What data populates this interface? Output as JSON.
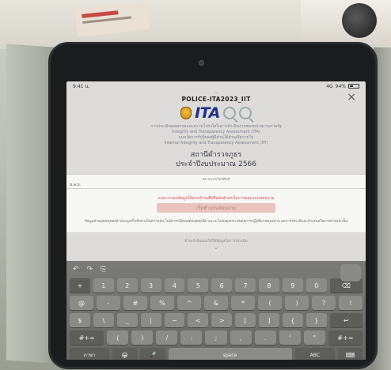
{
  "status_bar": {
    "time": "9:41 น.",
    "signal": "4G",
    "battery": "94%"
  },
  "nav": {
    "title": "POLICE-ITA2023_IIT",
    "close_icon": "close-icon"
  },
  "logo": {
    "text": "ITA",
    "emblem_icon": "police-emblem-icon",
    "magnifier_icon": "magnifier-icon"
  },
  "header": {
    "sub_lines": [
      "การประเมินคุณธรรมและความโปร่งใสในการดำเนินงานของหน่วยงานภาครัฐ",
      "Integrity and Transparency Assessment (ITA)",
      "แบบวัดการรับรู้ของผู้มีส่วนได้ส่วนเสียภายใน",
      "Internal Integrity and Transparency Assessment (IIT)"
    ],
    "agency": "สถานีตำรวจภูธร",
    "fiscal_year": "ประจำปีงบประมาณ 2566"
  },
  "form": {
    "field_label": "หมายเลขโทรศัพท์",
    "field_value": "บ.ล.บ.",
    "warning": "กรุณากรอกข้อมูลให้ครบถ้วนเพื่อยืนยันตัวตนในการตอบแบบสอบถาม",
    "submit_label": "เริ่มทำแบบสอบถาม",
    "notice": "ข้อมูลส่วนบุคคลของท่านจะถูกเก็บรักษาเป็นความลับ ไม่มีการเปิดเผยต่อบุคคลใด และจะไม่ส่งผลกระทบต่อการปฏิบัติงานของท่าน ผลการประเมินจะนำเสนอในภาพรวมเท่านั้น",
    "consent": "ข้าพเจ้ายินยอมให้ใช้ข้อมูลในการประเมิน",
    "chevron_icon": "chevron-down-icon"
  },
  "keyboard": {
    "toolbar": [
      "↶",
      "↷",
      "⎘"
    ],
    "rows": [
      [
        "+",
        "1",
        "2",
        "3",
        "4",
        "5",
        "6",
        "7",
        "8",
        "9",
        "0",
        "⌫"
      ],
      [
        "@",
        "-",
        "#",
        "%",
        "^",
        "&",
        "*",
        "(",
        ")",
        "?",
        "!"
      ],
      [
        "$",
        "\\",
        "_",
        "|",
        "~",
        "<",
        ">",
        "[",
        "]",
        "{",
        "}",
        "↩"
      ],
      [
        "#+=",
        "(",
        ")",
        "/",
        ":",
        ";",
        ",",
        ".",
        "'",
        "\"",
        "#+="
      ],
      [
        "ภาษา",
        "😀",
        "🎤",
        "space",
        "ABC",
        "⌨"
      ]
    ]
  }
}
